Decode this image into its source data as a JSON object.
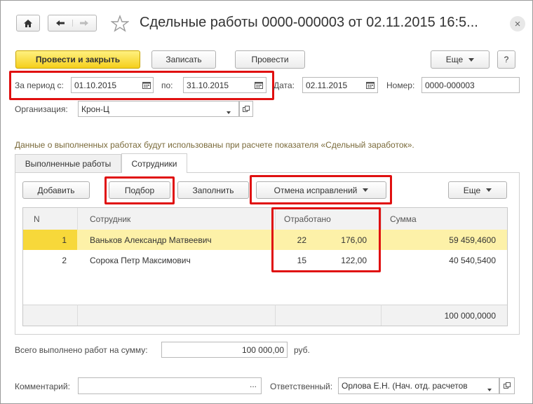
{
  "window": {
    "title": "Сдельные работы 0000-000003 от 02.11.2015 16:5...",
    "close_glyph": "×"
  },
  "toolbar": {
    "post_close": "Провести и закрыть",
    "save": "Записать",
    "post": "Провести",
    "more": "Еще",
    "help": "?"
  },
  "header": {
    "period_from_label": "За период с:",
    "period_from": "01.10.2015",
    "period_to_label": "по:",
    "period_to": "31.10.2015",
    "date_label": "Дата:",
    "date": "02.11.2015",
    "number_label": "Номер:",
    "number": "0000-000003",
    "org_label": "Организация:",
    "org": "Крон-Ц"
  },
  "info_text": "Данные о выполненных работах будут использованы при расчете показателя «Сдельный заработок».",
  "tabs": [
    {
      "label": "Выполненные работы",
      "active": false
    },
    {
      "label": "Сотрудники",
      "active": true
    }
  ],
  "grid_toolbar": {
    "add": "Добавить",
    "select": "Подбор",
    "fill": "Заполнить",
    "cancel_corrections": "Отмена исправлений",
    "more": "Еще"
  },
  "table": {
    "columns": [
      "N",
      "Сотрудник",
      "Отработано",
      "Сумма"
    ],
    "rows": [
      {
        "n": "1",
        "employee": "Ваньков Александр Матвеевич",
        "days": "22",
        "hours": "176,00",
        "sum": "59 459,4600",
        "selected": true
      },
      {
        "n": "2",
        "employee": "Сорока Петр Максимович",
        "days": "15",
        "hours": "122,00",
        "sum": "40 540,5400",
        "selected": false
      }
    ],
    "footer_sum": "100 000,0000"
  },
  "total": {
    "label": "Всего выполнено работ на сумму:",
    "value": "100 000,00",
    "currency": "руб."
  },
  "footer": {
    "comment_label": "Комментарий:",
    "comment": "",
    "comment_btn": "...",
    "responsible_label": "Ответственный:",
    "responsible": "Орлова Е.Н. (Нач. отд. расчетов"
  },
  "colors": {
    "primary_button": "#f5cf1c",
    "highlight": "#e01010",
    "selected_row": "#fdf1a8",
    "selected_cell": "#f7d83a"
  }
}
